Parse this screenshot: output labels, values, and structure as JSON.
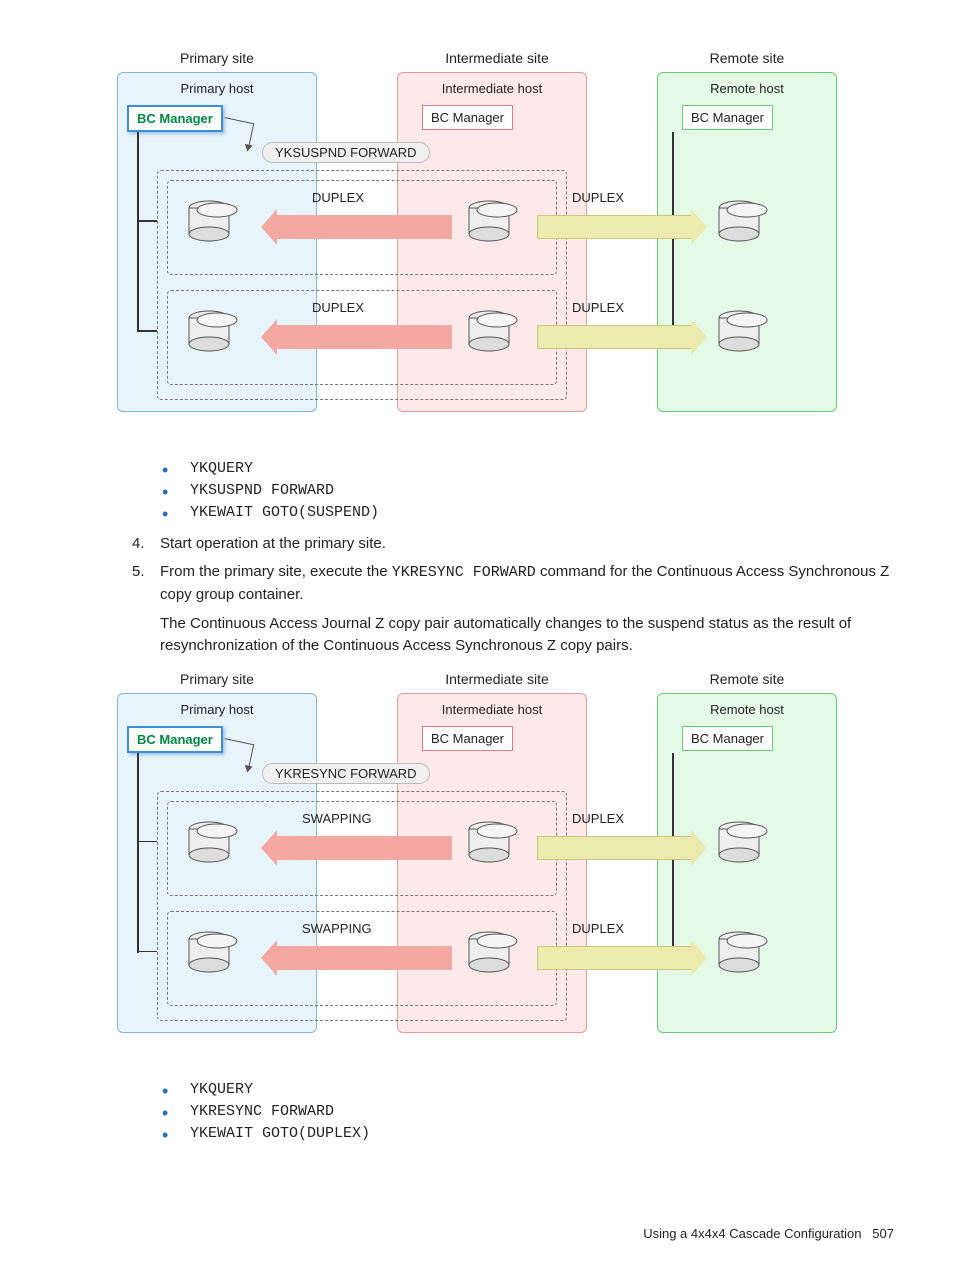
{
  "diagram1": {
    "sites": {
      "primary": "Primary site",
      "intermediate": "Intermediate site",
      "remote": "Remote site"
    },
    "hosts": {
      "primary": "Primary host",
      "intermediate": "Intermediate host",
      "remote": "Remote host"
    },
    "bcm": {
      "primary": "BC Manager",
      "intermediate": "BC Manager",
      "remote": "BC Manager"
    },
    "command_bubble": "YKSUSPND FORWARD",
    "pair1_left": "DUPLEX",
    "pair1_right": "DUPLEX",
    "pair2_left": "DUPLEX",
    "pair2_right": "DUPLEX"
  },
  "commands1": [
    "YKQUERY",
    "YKSUSPND FORWARD",
    "YKEWAIT GOTO(SUSPEND)"
  ],
  "step4": {
    "num": "4.",
    "text": "Start operation at the primary site."
  },
  "step5": {
    "num": "5.",
    "pre": "From the primary site, execute the ",
    "code": "YKRESYNC FORWARD",
    "post": " command for the Continuous Access Synchronous Z copy group container."
  },
  "para": "The Continuous Access Journal Z copy pair automatically changes to the suspend status as the result of resynchronization of the Continuous Access Synchronous Z copy pairs.",
  "diagram2": {
    "sites": {
      "primary": "Primary site",
      "intermediate": "Intermediate site",
      "remote": "Remote site"
    },
    "hosts": {
      "primary": "Primary host",
      "intermediate": "Intermediate host",
      "remote": "Remote host"
    },
    "bcm": {
      "primary": "BC Manager",
      "intermediate": "BC Manager",
      "remote": "BC Manager"
    },
    "command_bubble": "YKRESYNC FORWARD",
    "pair1_left": "SWAPPING",
    "pair1_right": "DUPLEX",
    "pair2_left": "SWAPPING",
    "pair2_right": "DUPLEX"
  },
  "commands2": [
    "YKQUERY",
    "YKRESYNC FORWARD",
    "YKEWAIT GOTO(DUPLEX)"
  ],
  "footer": {
    "text": "Using a 4x4x4 Cascade Configuration",
    "page": "507"
  }
}
